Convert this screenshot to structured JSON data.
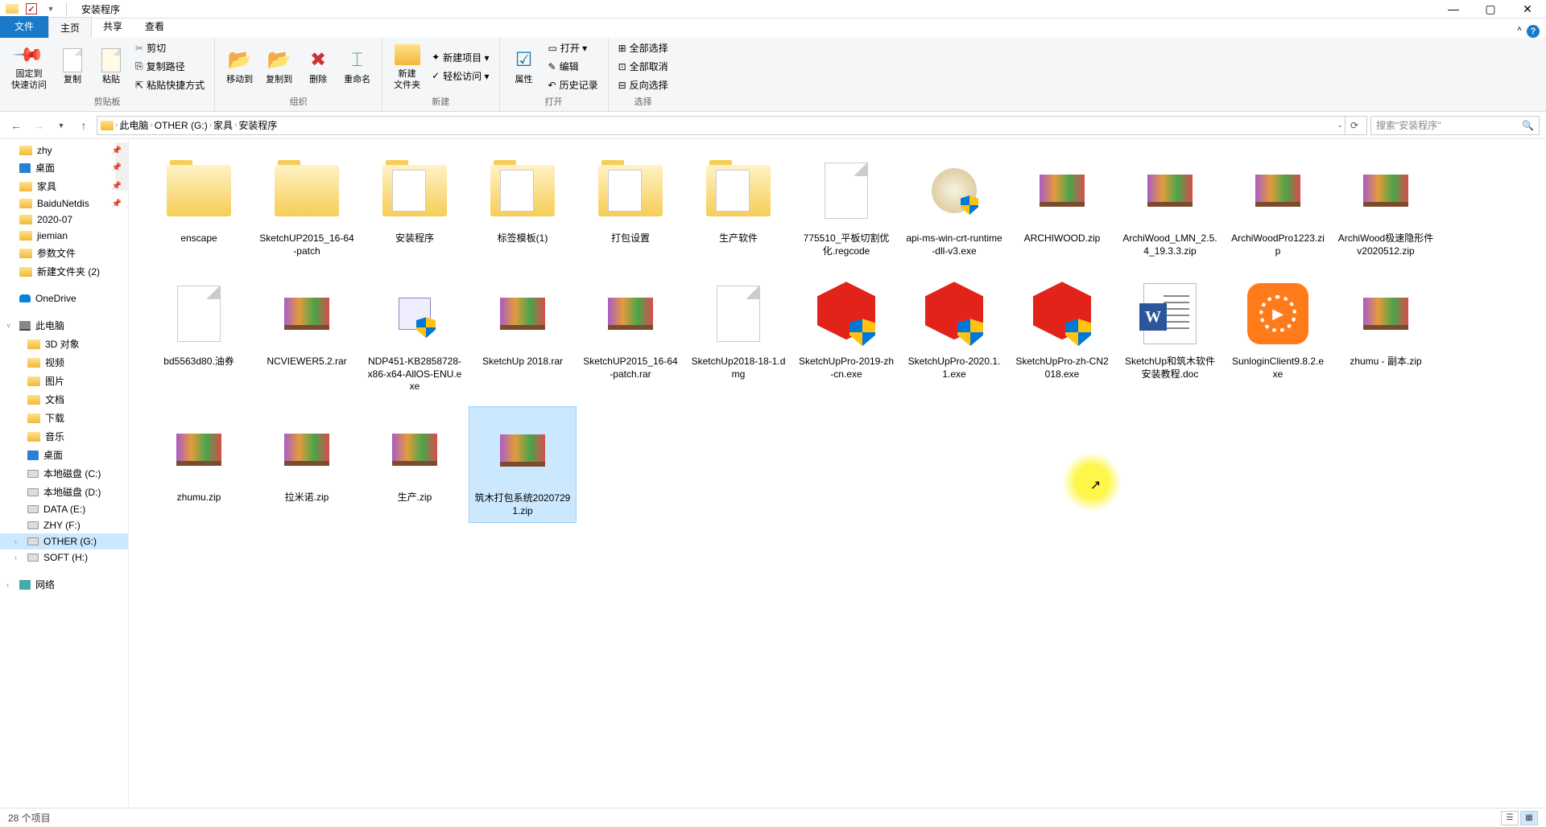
{
  "window": {
    "title": "安装程序"
  },
  "tabs": {
    "file": "文件",
    "home": "主页",
    "share": "共享",
    "view": "查看"
  },
  "ribbon": {
    "clipboard": {
      "label": "剪贴板",
      "pin": "固定到\n快速访问",
      "copy": "复制",
      "paste": "粘贴",
      "cut": "剪切",
      "copypath": "复制路径",
      "shortcut": "粘贴快捷方式"
    },
    "organize": {
      "label": "组织",
      "moveTo": "移动到",
      "copyTo": "复制到",
      "delete": "删除",
      "rename": "重命名"
    },
    "new": {
      "label": "新建",
      "newFolder": "新建\n文件夹",
      "newItem": "新建项目 ▾",
      "easyAccess": "轻松访问 ▾"
    },
    "open": {
      "label": "打开",
      "properties": "属性",
      "open": "打开 ▾",
      "edit": "编辑",
      "history": "历史记录"
    },
    "select": {
      "label": "选择",
      "selectAll": "全部选择",
      "selectNone": "全部取消",
      "invert": "反向选择"
    }
  },
  "breadcrumb": [
    "此电脑",
    "OTHER (G:)",
    "家具",
    "安装程序"
  ],
  "search": {
    "placeholder": "搜索\"安装程序\""
  },
  "nav": {
    "quick": [
      {
        "label": "zhy",
        "icon": "folder",
        "pinned": true
      },
      {
        "label": "桌面",
        "icon": "desktop",
        "pinned": true
      },
      {
        "label": "家具",
        "icon": "folder",
        "pinned": true
      },
      {
        "label": "BaiduNetdis",
        "icon": "folder",
        "pinned": true
      },
      {
        "label": "2020-07",
        "icon": "folder"
      },
      {
        "label": "jiemian",
        "icon": "folder"
      },
      {
        "label": "参数文件",
        "icon": "folder"
      },
      {
        "label": "新建文件夹 (2)",
        "icon": "folder"
      }
    ],
    "onedrive": "OneDrive",
    "thispc": {
      "label": "此电脑",
      "items": [
        "3D 对象",
        "视频",
        "图片",
        "文档",
        "下载",
        "音乐",
        "桌面",
        "本地磁盘 (C:)",
        "本地磁盘 (D:)",
        "DATA (E:)",
        "ZHY (F:)",
        "OTHER (G:)",
        "SOFT (H:)"
      ]
    },
    "network": "网络"
  },
  "files": [
    {
      "label": "enscape",
      "type": "folder"
    },
    {
      "label": "SketchUP2015_16-64-patch",
      "type": "folder"
    },
    {
      "label": "安装程序",
      "type": "folder-doc"
    },
    {
      "label": "标签模板(1)",
      "type": "folder-doc"
    },
    {
      "label": "打包设置",
      "type": "folder-doc"
    },
    {
      "label": "生产软件",
      "type": "folder-doc"
    },
    {
      "label": "775510_平板切割优化.regcode",
      "type": "reg"
    },
    {
      "label": "api-ms-win-crt-runtime-dll-v3.exe",
      "type": "api"
    },
    {
      "label": "ARCHIWOOD.zip",
      "type": "rar"
    },
    {
      "label": "ArchiWood_LMN_2.5.4_19.3.3.zip",
      "type": "rar"
    },
    {
      "label": "ArchiWoodPro1223.zip",
      "type": "rar"
    },
    {
      "label": "ArchiWood极速隐形件v2020512.zip",
      "type": "rar"
    },
    {
      "label": "bd5563d80.油券",
      "type": "dmg"
    },
    {
      "label": "NCVIEWER5.2.rar",
      "type": "rar"
    },
    {
      "label": "NDP451-KB2858728-x86-x64-AllOS-ENU.exe",
      "type": "net"
    },
    {
      "label": "SketchUp 2018.rar",
      "type": "rar"
    },
    {
      "label": "SketchUP2015_16-64-patch.rar",
      "type": "rar"
    },
    {
      "label": "SketchUp2018-18-1.dmg",
      "type": "dmg"
    },
    {
      "label": "SketchUpPro-2019-zh-cn.exe",
      "type": "su"
    },
    {
      "label": "SketchUpPro-2020.1.1.exe",
      "type": "su"
    },
    {
      "label": "SketchUpPro-zh-CN2018.exe",
      "type": "su"
    },
    {
      "label": "SketchUp和筑木软件安装教程.doc",
      "type": "word"
    },
    {
      "label": "SunloginClient9.8.2.exe",
      "type": "sun"
    },
    {
      "label": "zhumu - 副本.zip",
      "type": "rar"
    },
    {
      "label": "zhumu.zip",
      "type": "rar"
    },
    {
      "label": "拉米诺.zip",
      "type": "rar"
    },
    {
      "label": "生产.zip",
      "type": "rar"
    },
    {
      "label": "筑木打包系统20207291.zip",
      "type": "rar",
      "selected": true
    }
  ],
  "status": {
    "count": "28 个项目"
  }
}
